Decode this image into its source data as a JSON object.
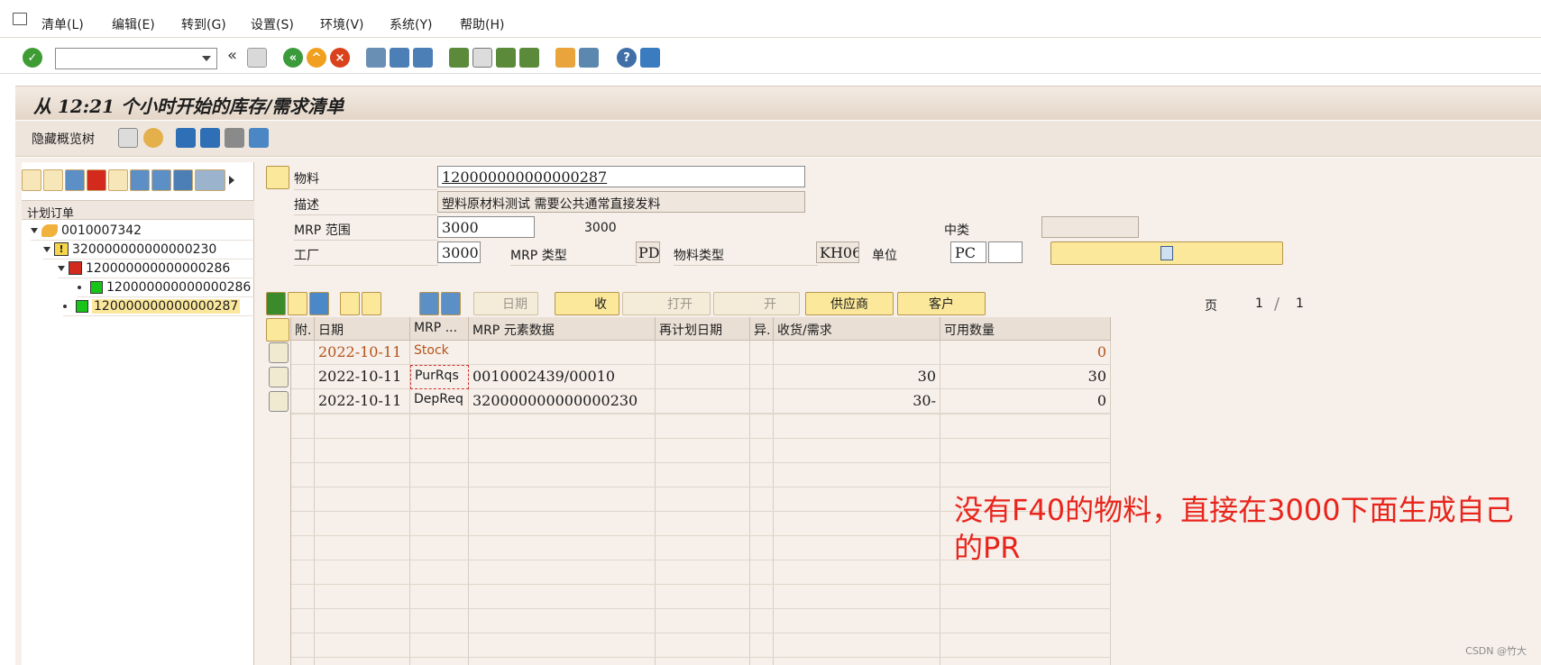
{
  "menu": [
    "清单(L)",
    "编辑(E)",
    "转到(G)",
    "设置(S)",
    "环境(V)",
    "系统(Y)",
    "帮助(H)"
  ],
  "window_title": "从 12:21 个小时开始的库存/需求清单",
  "app_toolbar_label": "隐藏概览树",
  "tree": {
    "header": "计划订单",
    "nodes": [
      {
        "text": "0010007342",
        "level": 0
      },
      {
        "text": "320000000000000230",
        "level": 1
      },
      {
        "text": "120000000000000286",
        "level": 2
      },
      {
        "text": "120000000000000286",
        "level": 3
      },
      {
        "text": "120000000000000287",
        "level": 1,
        "selected": true
      }
    ]
  },
  "header": {
    "material_label": "物料",
    "material_value": "120000000000000287",
    "desc_label": "描述",
    "desc_value": "塑料原材料测试 需要公共通常直接发料",
    "mrp_area_label": "MRP 范围",
    "mrp_area_value": "3000",
    "mrp_area_text": "3000",
    "middle_class_label": "中类",
    "plant_label": "工厂",
    "plant_value": "3000",
    "mrp_type_label": "MRP 类型",
    "mrp_type_value": "PD",
    "material_type_label": "物料类型",
    "material_type_value": "KH06",
    "unit_label": "单位",
    "unit_value": "PC"
  },
  "grid_buttons": {
    "date": "日期",
    "receive": "收",
    "open": "打开",
    "open2": "开",
    "vendor": "供应商",
    "customer": "客户"
  },
  "page": {
    "label": "页",
    "current": "1",
    "sep": "/",
    "total": "1"
  },
  "columns": [
    "附.",
    "日期",
    "MRP ...",
    "MRP 元素数据",
    "再计划日期",
    "异.",
    "收货/需求",
    "可用数量"
  ],
  "rows": [
    {
      "date": "2022-10-11",
      "mrp": "Stock",
      "data": "",
      "replan": "",
      "exc": "",
      "qty": "",
      "avail": "0"
    },
    {
      "date": "2022-10-11",
      "mrp": "PurRqs",
      "data": "0010002439/00010",
      "replan": "",
      "exc": "",
      "qty": "30",
      "avail": "30"
    },
    {
      "date": "2022-10-11",
      "mrp": "DepReq",
      "data": "320000000000000230",
      "replan": "",
      "exc": "",
      "qty": "30-",
      "avail": "0"
    }
  ],
  "annotation": [
    "没有F40的物料，直接在3000下面生成自己",
    "的PR"
  ],
  "watermark": "CSDN @竹大",
  "colors": {
    "accent": "#fbe89a",
    "annotation": "#e8251c",
    "stock": "#b5531a"
  }
}
